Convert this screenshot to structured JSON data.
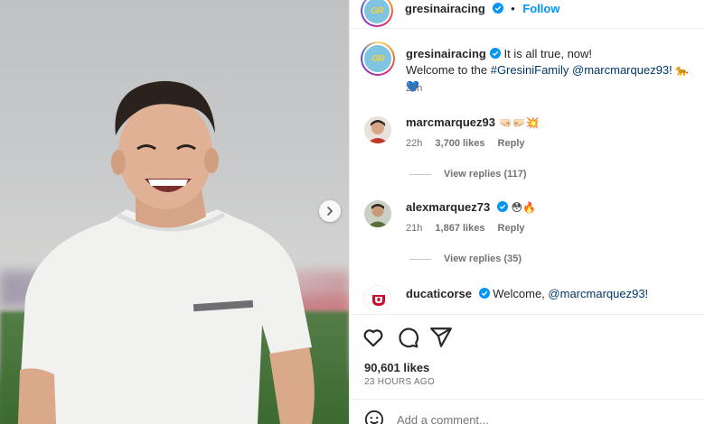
{
  "post": {
    "author": "gresinairacing",
    "avatar_logo_text": "GR",
    "follow_label": "Follow",
    "dot": "•",
    "caption_line1": "It is all true, now!",
    "caption_welcome": "Welcome to the",
    "caption_hashtag": "#GresiniFamily",
    "caption_mention": "@marcmarquez93!",
    "caption_emojis": "🐆 💙",
    "caption_time": "23h"
  },
  "comments": [
    {
      "username": "marcmarquez93",
      "text": "🤜🏻🤛🏻💥",
      "time": "22h",
      "likes": "3,700 likes",
      "reply_label": "Reply",
      "view_replies": "View replies (117)",
      "avatar_color": "#c0392b"
    },
    {
      "username": "alexmarquez73",
      "text": "😳🔥",
      "time": "21h",
      "likes": "1,867 likes",
      "reply_label": "Reply",
      "view_replies": "View replies (35)",
      "avatar_color": "#5d6d3a"
    },
    {
      "username": "ducaticorse",
      "text_prefix": "Welcome,",
      "mention": "@marcmarquez93!",
      "avatar_color": "#ffffff"
    }
  ],
  "stats": {
    "likes": "90,601 likes",
    "posted": "23 HOURS AGO"
  },
  "add_comment": {
    "placeholder": "Add a comment..."
  },
  "icons": [
    "heart-icon",
    "comment-icon",
    "share-icon",
    "emoji-icon",
    "verified-icon",
    "next-arrow-icon"
  ],
  "colors": {
    "follow_blue": "#0095f6",
    "link_blue": "#00376b",
    "verified_blue": "#0095f6",
    "muted_text": "#737373"
  }
}
